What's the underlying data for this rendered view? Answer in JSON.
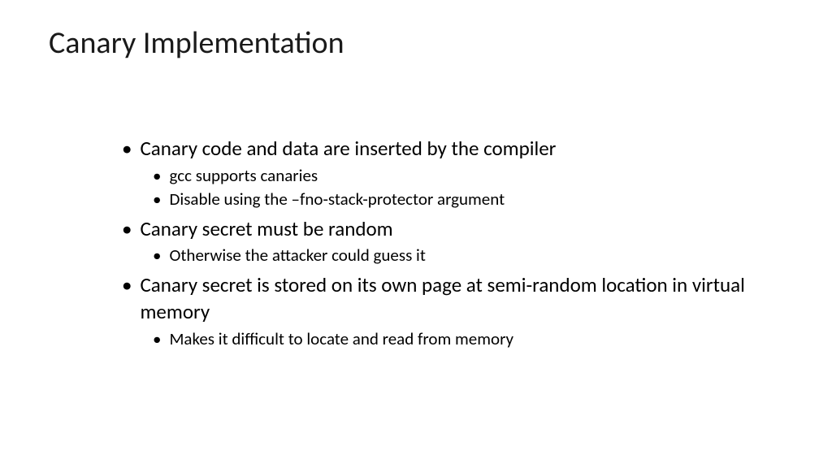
{
  "title": "Canary Implementation",
  "bullets": [
    {
      "text": "Canary code and data are inserted by the compiler",
      "sub": [
        "gcc supports canaries",
        "Disable using the –fno-stack-protector argument"
      ]
    },
    {
      "text": "Canary secret must be random",
      "sub": [
        "Otherwise the attacker could guess it"
      ]
    },
    {
      "text": "Canary secret is stored on its own page at semi-random location in virtual memory",
      "sub": [
        "Makes it difficult to locate and read from memory"
      ]
    }
  ]
}
